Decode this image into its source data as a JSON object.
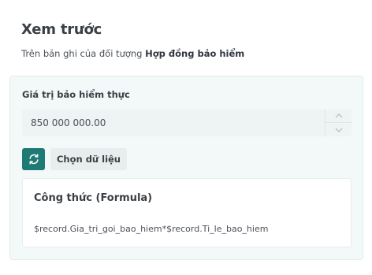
{
  "preview": {
    "title": "Xem trước",
    "subtitle_prefix": "Trên bản ghi của đối tượng ",
    "object_name": "Hợp đồng bảo hiểm"
  },
  "field": {
    "label": "Giá trị bảo hiểm thực",
    "value": "850 000 000.00"
  },
  "actions": {
    "refresh_icon": "refresh-icon",
    "choose_data_label": "Chọn dữ liệu"
  },
  "formula": {
    "title": "Công thức (Formula)",
    "expression": "$record.Gia_tri_goi_bao_hiem*$record.Ti_le_bao_hiem"
  },
  "colors": {
    "accent": "#1d7a75",
    "card_background": "#f3f8f8"
  }
}
